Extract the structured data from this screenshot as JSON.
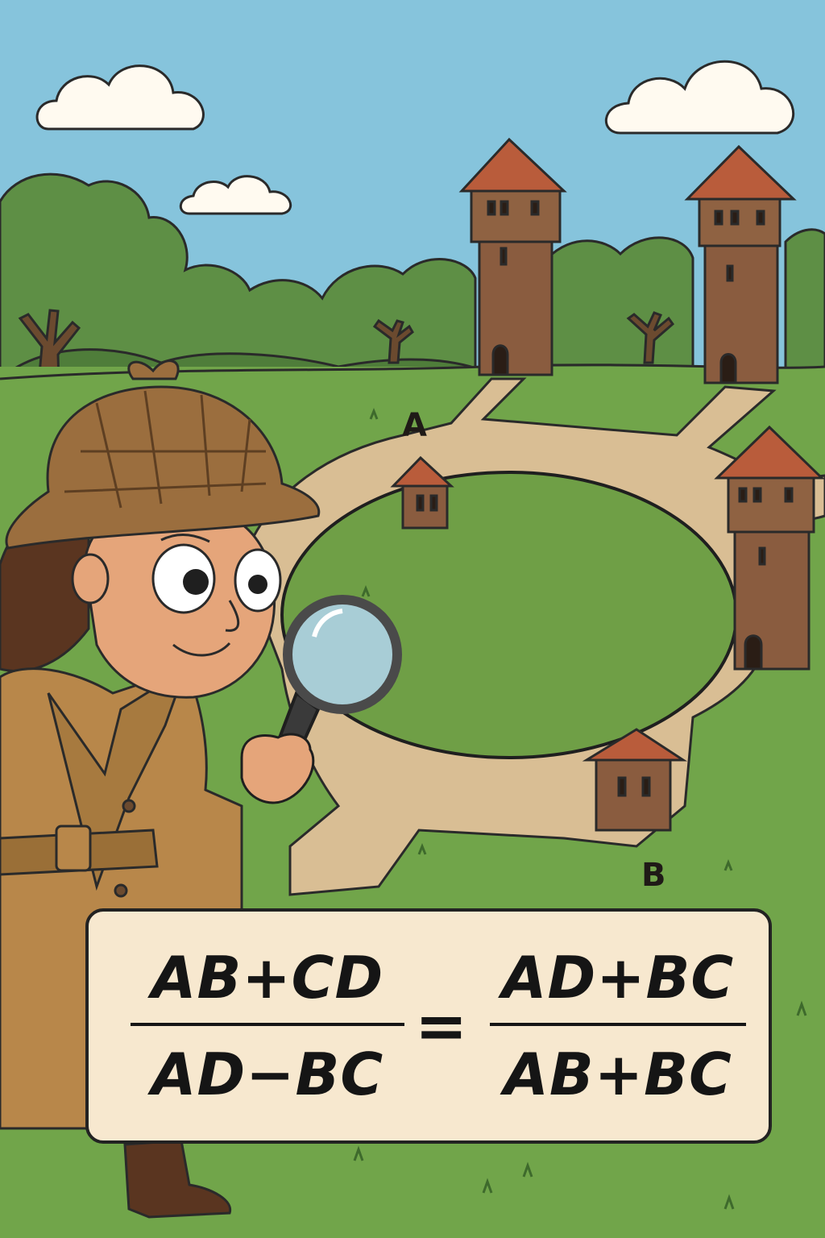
{
  "points": {
    "a": "A",
    "b": "B"
  },
  "formula": {
    "left_numerator": "AB+CD",
    "left_denominator": "AD−BC",
    "equals": "=",
    "right_numerator": "AD+BC",
    "right_denominator": "AB+BC"
  },
  "colors": {
    "sky": "#86c4dc",
    "grass": "#71a54a",
    "path": "#d9be94",
    "tower_wall": "#8a5c3f",
    "tower_roof": "#b95c3b",
    "coat": "#b8874a",
    "card": "#f7e8cf"
  },
  "icons": [
    "magnifying-glass-icon",
    "deerstalker-hat-icon",
    "tower-icon",
    "small-house-icon",
    "cloud-icon",
    "tree-icon"
  ]
}
